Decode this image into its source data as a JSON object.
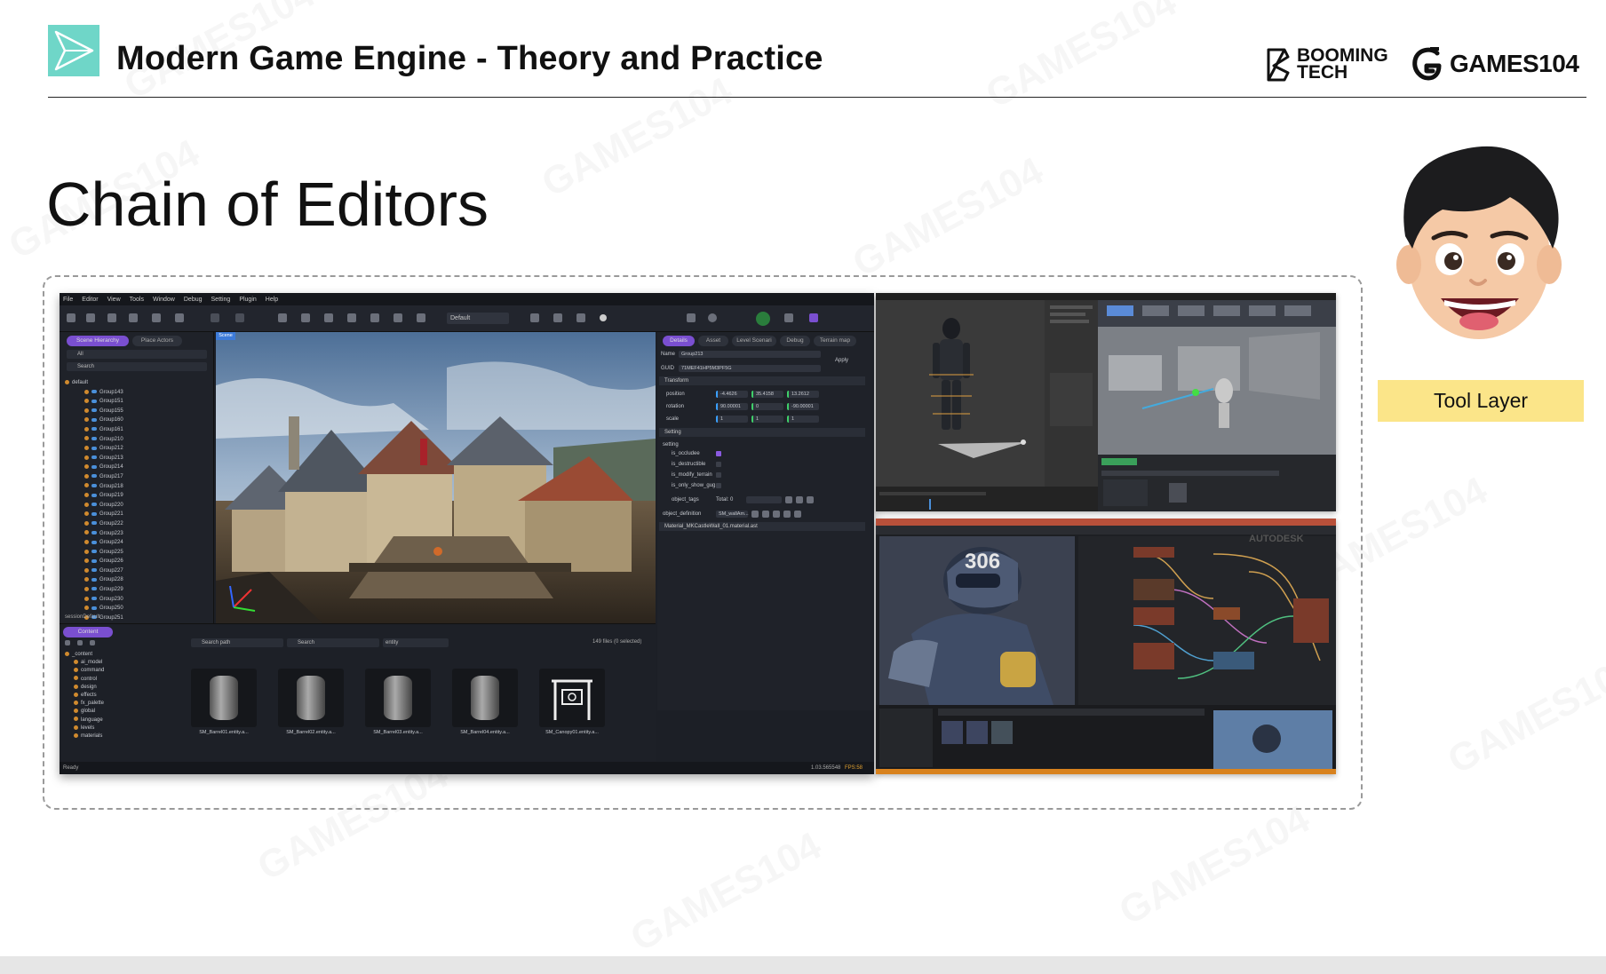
{
  "header": {
    "course_title": "Modern Game Engine - Theory and Practice",
    "brand_booming": "BOOMING TECH",
    "brand_games": "GAMES104"
  },
  "slide": {
    "title": "Chain of Editors",
    "callout_label": "Tool Layer"
  },
  "editor": {
    "menu": [
      "File",
      "Editor",
      "View",
      "Tools",
      "Window",
      "Debug",
      "Setting",
      "Plugin",
      "Help"
    ],
    "layout_dropdown": "Default",
    "left_tabs": [
      "Scene Hierarchy",
      "Place Actors"
    ],
    "filter_all": "All",
    "search_placeholder": "Search",
    "tree_root": "default",
    "tree_items": [
      "Group143",
      "Group151",
      "Group155",
      "Group160",
      "Group161",
      "Group210",
      "Group212",
      "Group213",
      "Group214",
      "Group217",
      "Group218",
      "Group219",
      "Group220",
      "Group221",
      "Group222",
      "Group223",
      "Group224",
      "Group225",
      "Group226",
      "Group227",
      "Group228",
      "Group229",
      "Group230",
      "Group250",
      "Group251"
    ],
    "session_label": "sessionDefault",
    "viewport_tab": "Scene",
    "right_tabs": [
      "Details",
      "Asset",
      "Level Scenari",
      "Debug",
      "Terrain map"
    ],
    "name_label": "Name",
    "name_value": "Group213",
    "apply_label": "Apply",
    "guid_label": "GUID",
    "guid_value": "71MEF41HP5M3PF5G",
    "transform_label": "Transform",
    "position_label": "position",
    "position_values": [
      "-4.4626",
      "35.4158",
      "13.2612"
    ],
    "rotation_label": "rotation",
    "rotation_values": [
      "90.00001",
      "0",
      "-90.00001"
    ],
    "scale_label": "scale",
    "scale_values": [
      "1",
      "1",
      "1"
    ],
    "setting_section": "Setting",
    "setting_sub": "setting",
    "flags": [
      {
        "label": "is_occludee",
        "on": true
      },
      {
        "label": "is_destructible",
        "on": false
      },
      {
        "label": "is_modify_terrain",
        "on": false
      },
      {
        "label": "is_only_show_gug...",
        "on": false
      }
    ],
    "object_tags_label": "object_tags",
    "object_tags_value": "Total: 0",
    "object_definition_label": "object_definition",
    "object_definition_value": "SM_wallAm...",
    "material_row": "Material_MKCastleWall_01.material.ast",
    "content_tab": "Content",
    "search_path_placeholder": "Search path",
    "content_search_placeholder": "Search",
    "type_filter": "entity",
    "file_count": "149 files (0 selected)",
    "content_tree": [
      "_content",
      "ai_model",
      "command",
      "control",
      "design",
      "effects",
      "fx_palette",
      "global",
      "language",
      "levels",
      "materials"
    ],
    "assets": [
      "SM_Barrel01.entity.a...",
      "SM_Barrel02.entity.a...",
      "SM_Barrel03.entity.a...",
      "SM_Barrel04.entity.a...",
      "SM_Canopy01.entity.a..."
    ],
    "status_ready": "Ready",
    "status_right": "1.03.565548",
    "status_fps": "FPS:58"
  },
  "collage": {
    "robot_number": "306",
    "autodesk_mark": "AUTODESK"
  }
}
